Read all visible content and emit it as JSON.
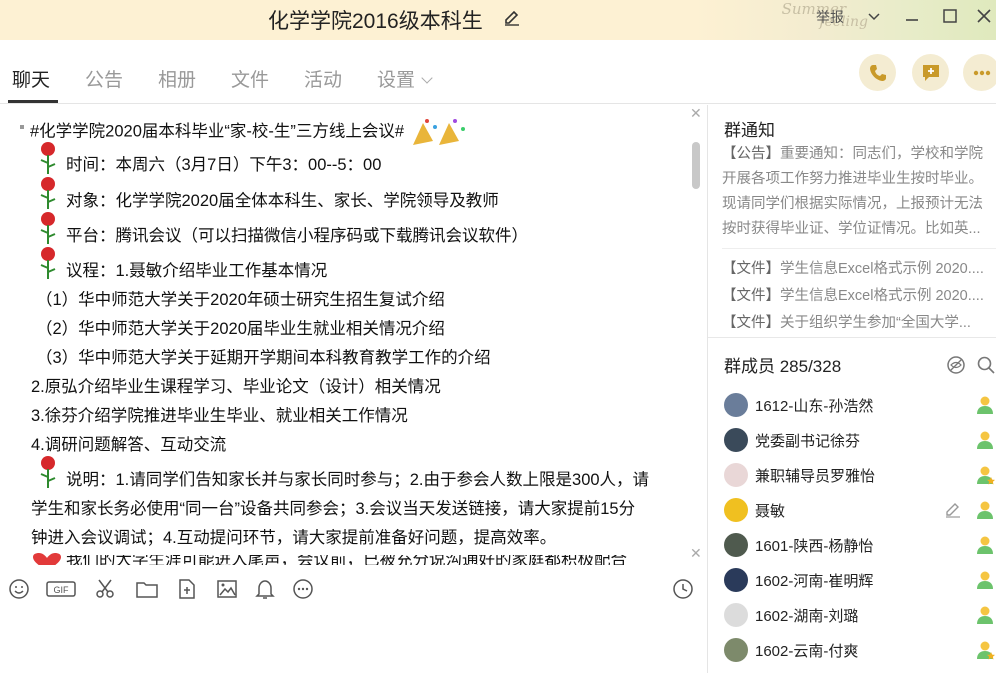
{
  "window": {
    "title": "化学学院2016级本科生",
    "report_label": "举报",
    "decor_text_1": "Summer",
    "decor_text_2": "feeling"
  },
  "tabs": [
    {
      "label": "聊天",
      "active": true
    },
    {
      "label": "公告"
    },
    {
      "label": "相册"
    },
    {
      "label": "文件"
    },
    {
      "label": "活动"
    },
    {
      "label": "设置"
    }
  ],
  "header_buttons": [
    "phone-icon",
    "message-plus-icon",
    "more-icon"
  ],
  "chat": {
    "lines": [
      "#化学学院2020届本科毕业“家-校-生”三方线上会议#",
      "时间：本周六（3月7日）下午3：00--5：00",
      "对象：化学学院2020届全体本科生、家长、学院领导及教师",
      "平台：腾讯会议（可以扫描微信小程序码或下载腾讯会议软件）",
      "议程：1.聂敏介绍毕业工作基本情况",
      "（1）华中师范大学关于2020年硕士研究生招生复试介绍",
      "（2）华中师范大学关于2020届毕业生就业相关情况介绍",
      "（3）华中师范大学关于延期开学期间本科教育教学工作的介绍",
      "2.原弘介绍毕业生课程学习、毕业论文（设计）相关情况",
      "3.徐芬介绍学院推进毕业生毕业、就业相关工作情况",
      "4.调研问题解答、互动交流",
      "说明：1.请同学们告知家长并与家长同时参与；2.由于参会人数上限是300人，请",
      "学生和家长务必使用“同一台”设备共同参会；3.会议当天发送链接，请大家提前15分",
      "钟进入会议调试；4.互动提问环节，请大家提前准备好问题，提高效率。"
    ],
    "partial_line": "我们的大学生涯可能进入尾声，会议前，已被充分说沟通好的家庭都积极配合"
  },
  "toolbar": [
    "emoji-icon",
    "gif-icon",
    "scissors-icon",
    "folder-icon",
    "file-transfer-icon",
    "image-icon",
    "bell-icon",
    "more-circle-icon",
    "history-clock-icon"
  ],
  "notice": {
    "title": "群通知",
    "tag": "【公告】",
    "text": "重要通知：同志们，学校和学院开展各项工作努力推进毕业生按时毕业。现请同学们根据实际情况，上报预计无法按时获得毕业证、学位证情况。比如英..."
  },
  "files": [
    {
      "tag": "【文件】",
      "name": "学生信息Excel格式示例 2020...."
    },
    {
      "tag": "【文件】",
      "name": "学生信息Excel格式示例 2020...."
    },
    {
      "tag": "【文件】",
      "name": "关于组织学生参加“全国大学..."
    }
  ],
  "members": {
    "title": "群成员 285/328",
    "list": [
      {
        "name": "1612-山东-孙浩然",
        "avatar_color": "#6a7d9a",
        "status": "user-icon"
      },
      {
        "name": "党委副书记徐芬",
        "avatar_color": "#3a4a5a",
        "status": "user-icon"
      },
      {
        "name": "兼职辅导员罗雅怡",
        "avatar_color": "#e9d7d7",
        "status": "user-star-icon"
      },
      {
        "name": "聂敏",
        "avatar_color": "#f0c020",
        "status": "user-icon",
        "editable": true
      },
      {
        "name": "1601-陕西-杨静怡",
        "avatar_color": "#4f5a4e",
        "status": "user-icon"
      },
      {
        "name": "1602-河南-崔明辉",
        "avatar_color": "#2a3a5a",
        "status": "user-icon"
      },
      {
        "name": "1602-湖南-刘璐",
        "avatar_color": "#dcdcdc",
        "status": "user-icon"
      },
      {
        "name": "1602-云南-付爽",
        "avatar_color": "#7d8a6b",
        "status": "user-star-icon"
      }
    ]
  }
}
